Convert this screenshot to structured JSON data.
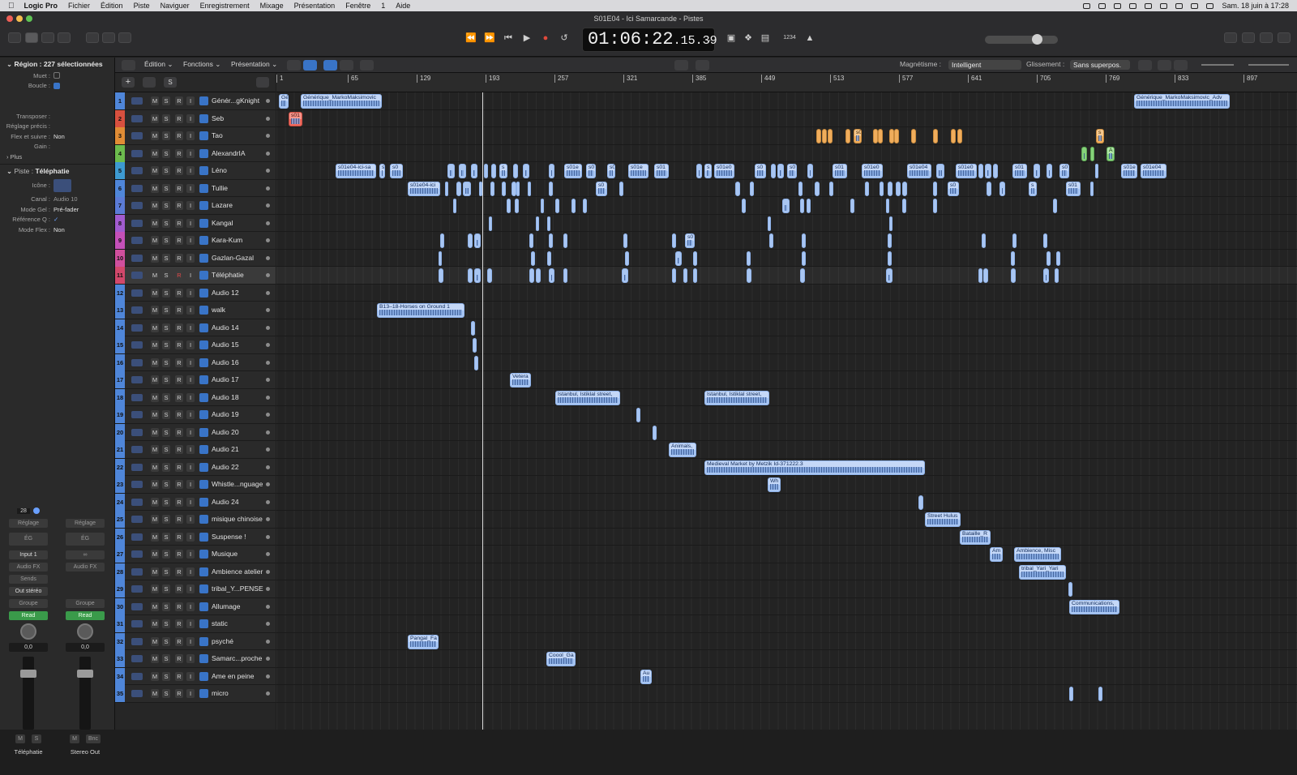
{
  "menubar": {
    "app": "Logic Pro",
    "items": [
      "Fichier",
      "Édition",
      "Piste",
      "Naviguer",
      "Enregistrement",
      "Mixage",
      "Présentation",
      "Fenêtre",
      "1",
      "Aide"
    ],
    "datetime": "Sam. 18 juin à 17:28"
  },
  "window": {
    "title": "S01E04 - Ici Samarcande - Pistes"
  },
  "transport": {
    "lcd_main": "01:06:22",
    "lcd_frames": ".15.39",
    "tempo_indicator": "1234"
  },
  "inspector": {
    "region_header": "Région : 227 sélectionnées",
    "region_fields": [
      {
        "label": "Muet :",
        "value": ""
      },
      {
        "label": "Boucle :",
        "value": ""
      },
      {
        "label": "Transposer :",
        "value": ""
      },
      {
        "label": "Réglage précis :",
        "value": ""
      },
      {
        "label": "Flex et suivre :",
        "value": "Non"
      },
      {
        "label": "Gain :",
        "value": ""
      }
    ],
    "more": "Plus",
    "track_header": "Piste :",
    "track_name": "Téléphatie",
    "track_fields": [
      {
        "label": "Icône :",
        "value": ""
      },
      {
        "label": "Canal :",
        "value": "Audio 10"
      },
      {
        "label": "Mode Gel :",
        "value": "Pré-fader"
      },
      {
        "label": "Référence Q :",
        "value": "✓"
      },
      {
        "label": "Mode Flex :",
        "value": "Non"
      }
    ],
    "strip_left": {
      "value": "28",
      "setting": "Réglage",
      "eq": "ÉG",
      "input": "Input 1",
      "audio_fx": "Audio FX",
      "sends": "Sends",
      "output": "Out stéréo",
      "group": "Groupe",
      "automation": "Read",
      "pan": "0,0",
      "m": "M",
      "s": "S",
      "name": "Téléphatie"
    },
    "strip_right": {
      "setting": "Réglage",
      "eq": "ÉG",
      "audio_fx": "Audio FX",
      "group": "Groupe",
      "automation": "Read",
      "pan": "0,0",
      "bnc": "Bnc",
      "m": "M",
      "name": "Stereo Out"
    }
  },
  "toolbar": {
    "edition": "Édition",
    "fonctions": "Fonctions",
    "presentation": "Présentation",
    "magnet_label": "Magnétisme :",
    "magnet_value": "Intelligent",
    "drag_label": "Glissement :",
    "drag_value": "Sans superpos."
  },
  "ruler": [
    "1",
    "65",
    "129",
    "193",
    "257",
    "321",
    "385",
    "449",
    "513",
    "577",
    "641",
    "705",
    "769",
    "833",
    "897"
  ],
  "tracks": [
    {
      "n": "1",
      "name": "Génér...gKnight",
      "color": "#4f86d9"
    },
    {
      "n": "2",
      "name": "Seb",
      "color": "#d8503f"
    },
    {
      "n": "3",
      "name": "Tao",
      "color": "#e08c35"
    },
    {
      "n": "4",
      "name": "AlexandrIA",
      "color": "#6cbc4d"
    },
    {
      "n": "5",
      "name": "Léno",
      "color": "#3d9ad1"
    },
    {
      "n": "6",
      "name": "Tullie",
      "color": "#4f86d9"
    },
    {
      "n": "7",
      "name": "Lazare",
      "color": "#5b7bd6"
    },
    {
      "n": "8",
      "name": "Kangal",
      "color": "#a25bcf"
    },
    {
      "n": "9",
      "name": "Kara-Kum",
      "color": "#c550b9"
    },
    {
      "n": "10",
      "name": "Gazlan-Gazal",
      "color": "#d04f9d"
    },
    {
      "n": "11",
      "name": "Téléphatie",
      "color": "#d2486b"
    },
    {
      "n": "12",
      "name": "Audio 12",
      "color": "#4f86d9"
    },
    {
      "n": "13",
      "name": "walk",
      "color": "#4f86d9"
    },
    {
      "n": "14",
      "name": "Audio 14",
      "color": "#4f86d9"
    },
    {
      "n": "15",
      "name": "Audio 15",
      "color": "#4f86d9"
    },
    {
      "n": "16",
      "name": "Audio 16",
      "color": "#4f86d9"
    },
    {
      "n": "17",
      "name": "Audio 17",
      "color": "#4f86d9"
    },
    {
      "n": "18",
      "name": "Audio 18",
      "color": "#4f86d9"
    },
    {
      "n": "19",
      "name": "Audio 19",
      "color": "#4f86d9"
    },
    {
      "n": "20",
      "name": "Audio 20",
      "color": "#4f86d9"
    },
    {
      "n": "21",
      "name": "Audio 21",
      "color": "#4f86d9"
    },
    {
      "n": "22",
      "name": "Audio 22",
      "color": "#4f86d9"
    },
    {
      "n": "23",
      "name": "Whistle...nguage",
      "color": "#4f86d9"
    },
    {
      "n": "24",
      "name": "Audio 24",
      "color": "#4f86d9"
    },
    {
      "n": "25",
      "name": "misique chinoise",
      "color": "#4f86d9"
    },
    {
      "n": "26",
      "name": "Suspense !",
      "color": "#4f86d9"
    },
    {
      "n": "27",
      "name": "Musique",
      "color": "#4f86d9"
    },
    {
      "n": "28",
      "name": "Ambience atelier",
      "color": "#4f86d9"
    },
    {
      "n": "29",
      "name": "tribal_Y...PENSE",
      "color": "#4f86d9"
    },
    {
      "n": "30",
      "name": "Allumage",
      "color": "#4f86d9"
    },
    {
      "n": "31",
      "name": "static",
      "color": "#4f86d9"
    },
    {
      "n": "32",
      "name": "psyché",
      "color": "#4f86d9"
    },
    {
      "n": "33",
      "name": "Samarc...proche",
      "color": "#4f86d9"
    },
    {
      "n": "34",
      "name": "Ame en peine",
      "color": "#4f86d9"
    },
    {
      "n": "35",
      "name": "micro",
      "color": "#4f86d9"
    }
  ],
  "regions": {
    "r1": "Génér",
    "r2": "Générique_MarkoMaksimovic",
    "r3": "Générique_MarkoMaksimovic_Adv",
    "r4": "s01",
    "r5": "s0",
    "r6": "s",
    "r7": "A",
    "r8": "s01e04-ici-sa",
    "r9": "s",
    "r10": "s0",
    "r11": "s01e",
    "r12": "s0",
    "r13": "s0",
    "r14": "s01e",
    "r15": "s01",
    "r16": "s",
    "r17": "s01e0",
    "r18": "s0",
    "r19": "s0",
    "r20": "s01",
    "r21": "s01e0",
    "r22": "s01e04",
    "r23": "s01e0",
    "r24": "s01",
    "r25": "s0",
    "r26": "s01e",
    "r27": "s01e04",
    "r28": "s01e04-ici",
    "r29": "s0",
    "r30": "s0",
    "r31": "s",
    "r32": "s01",
    "r33": "s0",
    "r34": "B13–18-Horses on Ground 1",
    "r35": "Vetera",
    "r36": "Istanbul, Istiklal street,",
    "r37": "Istanbul, Istiklal street,",
    "r38": "Animals,",
    "r39": "Medieval Market by Metzik Id-371222.3",
    "r40": "Wh",
    "r41": "Street Hulus",
    "r42": "Bataille_R",
    "r43": "Am",
    "r44": "Ambience, Misc",
    "r45": "tribal_Yari_Yari",
    "r46": "Communications,",
    "r47": "Pangal_Fa",
    "r48": "Coool_Ga",
    "r49": "Au"
  }
}
